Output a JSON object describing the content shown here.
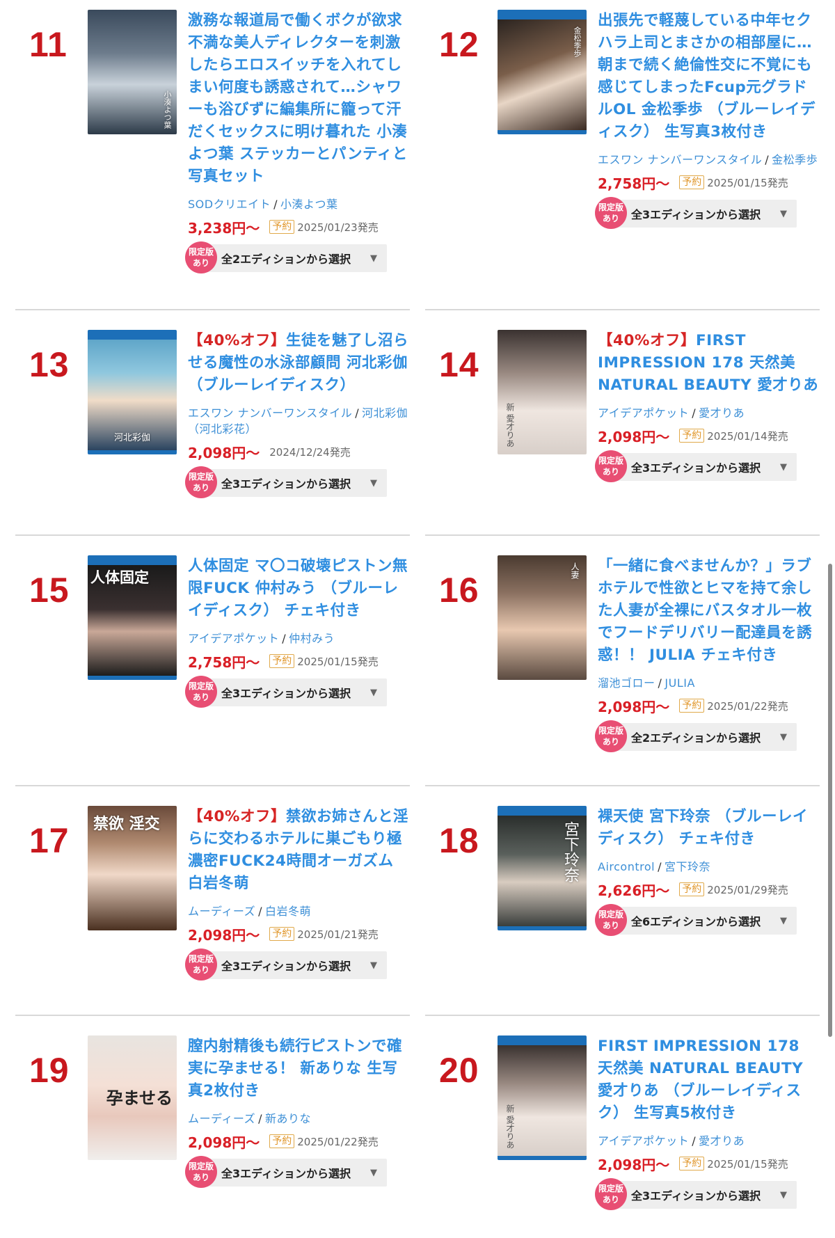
{
  "colors": {
    "rank": "#c8181e",
    "title": "#2f8ee0",
    "discount": "#d62424",
    "price": "#d91f26",
    "badge": "#e84e73",
    "link": "#3d8fd6",
    "reserve": "#e0962a",
    "bluray": "#1c6fb8"
  },
  "items": [
    {
      "rank": "11",
      "title": "激務な報道局で働くボクが欲求不満な美人ディレクターを刺激したらエロスイッチを入れてしまい何度も誘惑されて…シャワーも浴びずに編集所に籠って汗だくセックスに明け暮れた 小湊よつ葉 ステッカーとパンティと写真セット",
      "discount": "",
      "maker": "SODクリエイト",
      "performer": "小湊よつ葉",
      "price": "3,238円〜",
      "reserve": "予約",
      "date": "2025/01/23発売",
      "limited": [
        "限定版",
        "あり"
      ],
      "edition": "全2エディションから選択",
      "cover_text": "小湊よつ葉",
      "bluray": false
    },
    {
      "rank": "12",
      "title": "出張先で軽蔑している中年セクハラ上司とまさかの相部屋に…朝まで続く絶倫性交に不覚にも感じてしまったFcup元グラドルOL 金松季歩 （ブルーレイディスク） 生写真3枚付き",
      "discount": "",
      "maker": "エスワン ナンバーワンスタイル",
      "performer": "金松季歩",
      "price": "2,758円〜",
      "reserve": "予約",
      "date": "2025/01/15発売",
      "limited": [
        "限定版",
        "あり"
      ],
      "edition": "全3エディションから選択",
      "cover_text": "金松季歩",
      "bluray": true
    },
    {
      "rank": "13",
      "title": "生徒を魅了し沼らせる魔性の水泳部顧問 河北彩伽（ブルーレイディスク）",
      "discount": "【40%オフ】",
      "maker": "エスワン ナンバーワンスタイル",
      "performer": "河北彩伽（河北彩花）",
      "price": "2,098円〜",
      "reserve": "",
      "date": "2024/12/24発売",
      "limited": [
        "限定版",
        "あり"
      ],
      "edition": "全3エディションから選択",
      "cover_text": "河北彩伽",
      "bluray": true
    },
    {
      "rank": "14",
      "title": "FIRST IMPRESSION 178 天然美 NATURAL BEAUTY 愛才りあ",
      "discount": "【40%オフ】",
      "maker": "アイデアポケット",
      "performer": "愛才りあ",
      "price": "2,098円〜",
      "reserve": "予約",
      "date": "2025/01/14発売",
      "limited": [
        "限定版",
        "あり"
      ],
      "edition": "全3エディションから選択",
      "cover_text": "新 愛才りあ",
      "bluray": false
    },
    {
      "rank": "15",
      "title": "人体固定 マ〇コ破壊ピストン無限FUCK 仲村みう （ブルーレイディスク） チェキ付き",
      "discount": "",
      "maker": "アイデアポケット",
      "performer": "仲村みう",
      "price": "2,758円〜",
      "reserve": "予約",
      "date": "2025/01/15発売",
      "limited": [
        "限定版",
        "あり"
      ],
      "edition": "全3エディションから選択",
      "cover_text": "人体固定",
      "bluray": true
    },
    {
      "rank": "16",
      "title": "「一緒に食べませんか？」ラブホテルで性欲とヒマを持て余した人妻が全裸にバスタオル一枚でフードデリバリー配達員を誘惑！！ JULIA チェキ付き",
      "discount": "",
      "maker": "溜池ゴロー",
      "performer": "JULIA",
      "price": "2,098円〜",
      "reserve": "予約",
      "date": "2025/01/22発売",
      "limited": [
        "限定版",
        "あり"
      ],
      "edition": "全2エディションから選択",
      "cover_text": "人妻",
      "bluray": false
    },
    {
      "rank": "17",
      "title": "禁欲お姉さんと淫らに交わるホテルに巣ごもり極濃密FUCK24時間オーガズム 白岩冬萌",
      "discount": "【40%オフ】",
      "maker": "ムーディーズ",
      "performer": "白岩冬萌",
      "price": "2,098円〜",
      "reserve": "予約",
      "date": "2025/01/21発売",
      "limited": [
        "限定版",
        "あり"
      ],
      "edition": "全3エディションから選択",
      "cover_text": "禁欲 淫交",
      "bluray": false
    },
    {
      "rank": "18",
      "title": "裸天使 宮下玲奈 （ブルーレイディスク） チェキ付き",
      "discount": "",
      "maker": "Aircontrol",
      "performer": "宮下玲奈",
      "price": "2,626円〜",
      "reserve": "予約",
      "date": "2025/01/29発売",
      "limited": [
        "限定版",
        "あり"
      ],
      "edition": "全6エディションから選択",
      "cover_text": "宮下玲奈",
      "bluray": true
    },
    {
      "rank": "19",
      "title": "膣内射精後も続行ピストンで確実に孕ませる！ 新ありな 生写真2枚付き",
      "discount": "",
      "maker": "ムーディーズ",
      "performer": "新ありな",
      "price": "2,098円〜",
      "reserve": "予約",
      "date": "2025/01/22発売",
      "limited": [
        "限定版",
        "あり"
      ],
      "edition": "全3エディションから選択",
      "cover_text": "孕ませる",
      "bluray": false
    },
    {
      "rank": "20",
      "title": "FIRST IMPRESSION 178 天然美 NATURAL BEAUTY 愛才りあ （ブルーレイディスク） 生写真5枚付き",
      "discount": "",
      "maker": "アイデアポケット",
      "performer": "愛才りあ",
      "price": "2,098円〜",
      "reserve": "予約",
      "date": "2025/01/15発売",
      "limited": [
        "限定版",
        "あり"
      ],
      "edition": "全3エディションから選択",
      "cover_text": "新 愛才りあ",
      "bluray": true
    }
  ]
}
